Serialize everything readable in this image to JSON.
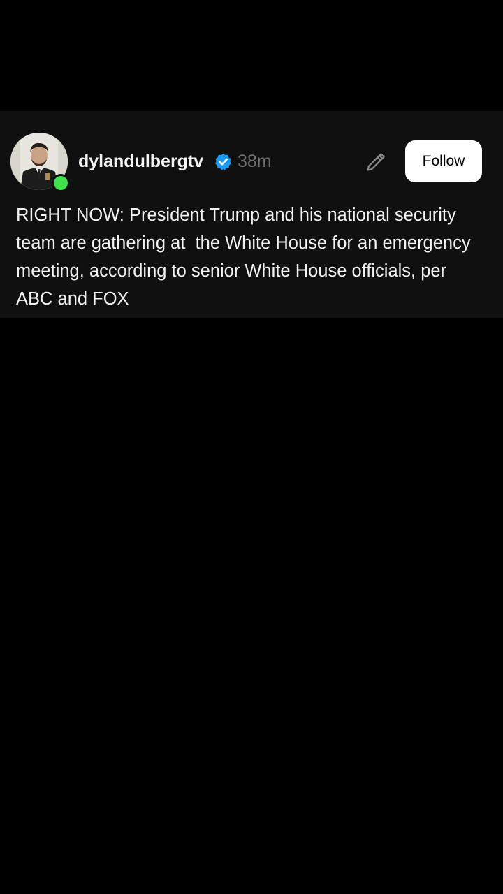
{
  "post": {
    "author": {
      "username": "dylandulbergtv",
      "verified": true,
      "online": true,
      "avatar_icon": "user-avatar-photo"
    },
    "timestamp": "38m",
    "actions": {
      "edit_icon": "pencil-icon",
      "follow_label": "Follow"
    },
    "body": "RIGHT NOW: President Trump and his national security team are gathering at  the White House for an emergency meeting, according to senior White House officials, per ABC and FOX"
  },
  "colors": {
    "background": "#000000",
    "card_background": "#101010",
    "text_primary": "#f5f5f5",
    "text_muted": "#6f6f6f",
    "verified_badge": "#1d9bf0",
    "online_indicator": "#3ee04b",
    "follow_button_bg": "#ffffff"
  }
}
